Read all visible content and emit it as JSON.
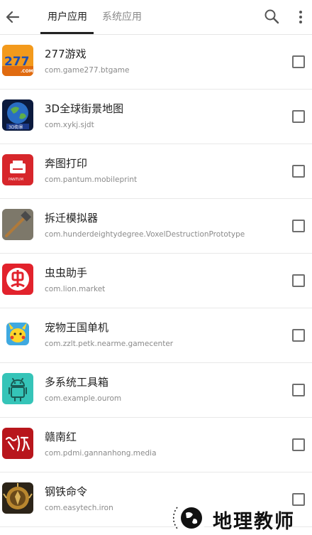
{
  "header": {
    "tabs": [
      {
        "label": "用户应用",
        "active": true
      },
      {
        "label": "系统应用",
        "active": false
      }
    ]
  },
  "apps": [
    {
      "name": "277游戏",
      "package": "com.game277.btgame",
      "icon": "game277-icon"
    },
    {
      "name": "3D全球街景地图",
      "package": "com.xykj.sjdt",
      "icon": "earth-icon"
    },
    {
      "name": "奔图打印",
      "package": "com.pantum.mobileprint",
      "icon": "printer-icon"
    },
    {
      "name": "拆迁模拟器",
      "package": "com.hunderdeightydegree.VoxelDestructionPrototype",
      "icon": "hammer-icon"
    },
    {
      "name": "虫虫助手",
      "package": "com.lion.market",
      "icon": "bug-icon"
    },
    {
      "name": "宠物王国单机",
      "package": "com.zzlt.petk.nearme.gamecenter",
      "icon": "pet-icon"
    },
    {
      "name": "多系统工具箱",
      "package": "com.example.ourom",
      "icon": "android-icon"
    },
    {
      "name": "赣南红",
      "package": "com.pdmi.gannanhong.media",
      "icon": "calligraphy-icon"
    },
    {
      "name": "钢铁命令",
      "package": "com.easytech.iron",
      "icon": "lion-emblem-icon"
    }
  ],
  "watermark": {
    "text": "地理教师"
  },
  "colors": {
    "accent": "#222222",
    "inactive": "#8a8a8a",
    "divider": "#e8e8e8"
  }
}
